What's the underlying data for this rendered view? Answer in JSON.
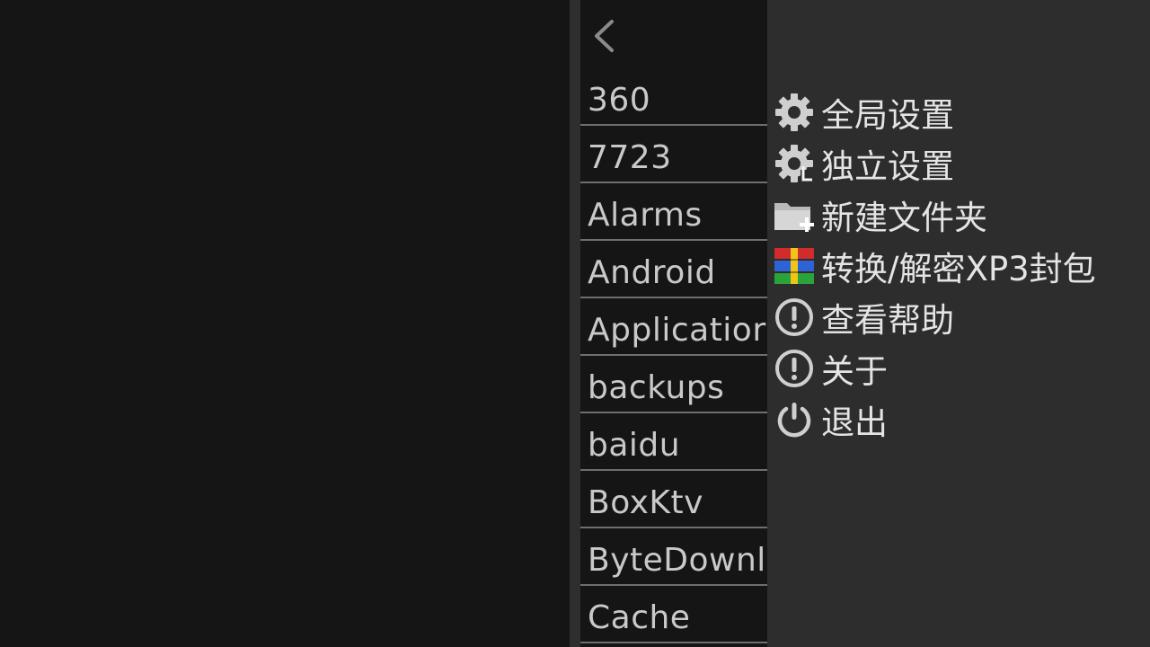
{
  "file_panel": {
    "items": [
      {
        "label": "360"
      },
      {
        "label": "7723"
      },
      {
        "label": "Alarms"
      },
      {
        "label": "Android"
      },
      {
        "label": "Applicatior"
      },
      {
        "label": "backups"
      },
      {
        "label": "baidu"
      },
      {
        "label": "BoxKtv"
      },
      {
        "label": "ByteDownl"
      },
      {
        "label": "Cache"
      }
    ]
  },
  "menu": {
    "items": [
      {
        "label": "全局设置",
        "icon": "gear-icon"
      },
      {
        "label": "独立设置",
        "icon": "gear-user-icon"
      },
      {
        "label": "新建文件夹",
        "icon": "folder-add-icon"
      },
      {
        "label": "转换/解密XP3封包",
        "icon": "archive-icon"
      },
      {
        "label": "查看帮助",
        "icon": "info-icon"
      },
      {
        "label": "关于",
        "icon": "info-icon"
      },
      {
        "label": "退出",
        "icon": "power-icon"
      }
    ]
  },
  "colors": {
    "background": "#141414",
    "menu_background": "#2d2d2d",
    "text": "#e4e4e4",
    "file_text": "#c9c9c9",
    "separator": "#6e6e6e"
  }
}
